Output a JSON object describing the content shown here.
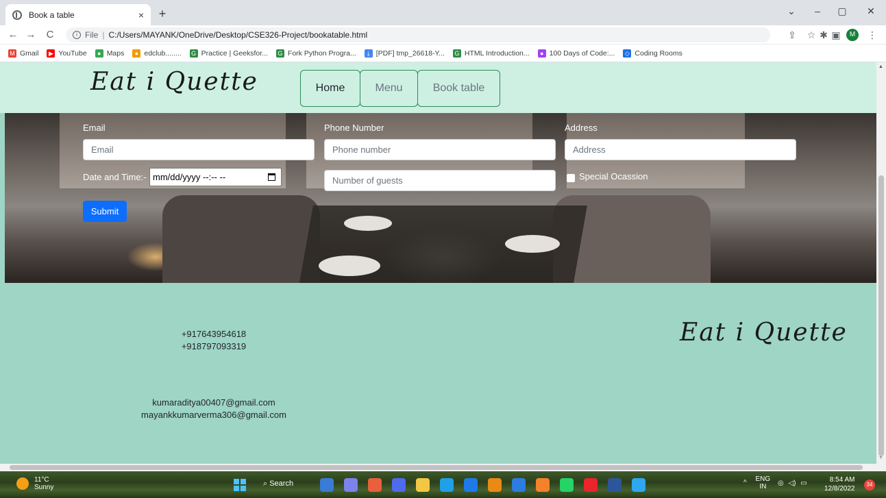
{
  "browser": {
    "tab_title": "Book a table",
    "tab_close": "×",
    "new_tab": "+",
    "window_controls": {
      "minimize": "–",
      "restore": "▢",
      "close": "✕",
      "tab_search": "⌄"
    },
    "nav": {
      "back": "←",
      "forward": "→",
      "reload": "C"
    },
    "address": {
      "scheme": "File",
      "path": "C:/Users/MAYANK/OneDrive/Desktop/CSE326-Project/bookatable.html"
    },
    "profile_initial": "M",
    "bookmarks": [
      {
        "label": "Gmail",
        "color": "#ea4335",
        "glyph": "M"
      },
      {
        "label": "YouTube",
        "color": "#ff0000",
        "glyph": "▶"
      },
      {
        "label": "Maps",
        "color": "#34a853",
        "glyph": "●"
      },
      {
        "label": "edclub........",
        "color": "#f29900",
        "glyph": "●"
      },
      {
        "label": "Practice | Geeksfor...",
        "color": "#2f8d46",
        "glyph": "G"
      },
      {
        "label": "Fork Python Progra...",
        "color": "#2f8d46",
        "glyph": "G"
      },
      {
        "label": "[PDF] tmp_26618-Y...",
        "color": "#4285f4",
        "glyph": "⤓"
      },
      {
        "label": "HTML Introduction...",
        "color": "#2f8d46",
        "glyph": "G"
      },
      {
        "label": "100 Days of Code:...",
        "color": "#a142f4",
        "glyph": "●"
      },
      {
        "label": "Coding Rooms",
        "color": "#1a73e8",
        "glyph": "◇"
      }
    ]
  },
  "site": {
    "logo": "Eat i Quette",
    "nav": [
      {
        "label": "Home",
        "active": true
      },
      {
        "label": "Menu",
        "active": false
      },
      {
        "label": "Book table",
        "active": false
      }
    ],
    "form": {
      "email_label": "Email",
      "email_placeholder": "Email",
      "phone_label": "Phone Number",
      "phone_placeholder": "Phone number",
      "address_label": "Address",
      "address_placeholder": "Address",
      "datetime_label": "Date and Time:-",
      "datetime_value": "mm/dd/yyyy --:-- --",
      "guests_placeholder": "Number of guests",
      "special_label": "Special Ocassion",
      "submit_label": "Submit"
    },
    "footer": {
      "phones": [
        "+917643954618",
        "+918797093319"
      ],
      "emails": [
        "kumaraditya00407@gmail.com",
        "mayankkumarverma306@gmail.com"
      ],
      "logo": "Eat i Quette"
    }
  },
  "taskbar": {
    "weather_temp": "11°C",
    "weather_cond": "Sunny",
    "search_label": "Search",
    "lang_top": "ENG",
    "lang_bottom": "IN",
    "time": "8:54 AM",
    "date": "12/8/2022",
    "notifications": "34",
    "apps": [
      "#3a7bd5",
      "#7b83eb",
      "#e8613c",
      "#4f6bed",
      "#f2c744",
      "#1fa0e8",
      "#1f7ae8",
      "#ea8a14",
      "#2d7de0",
      "#f5822a",
      "#25d366",
      "#e8252a",
      "#2b579a",
      "#2ea7f0"
    ]
  }
}
